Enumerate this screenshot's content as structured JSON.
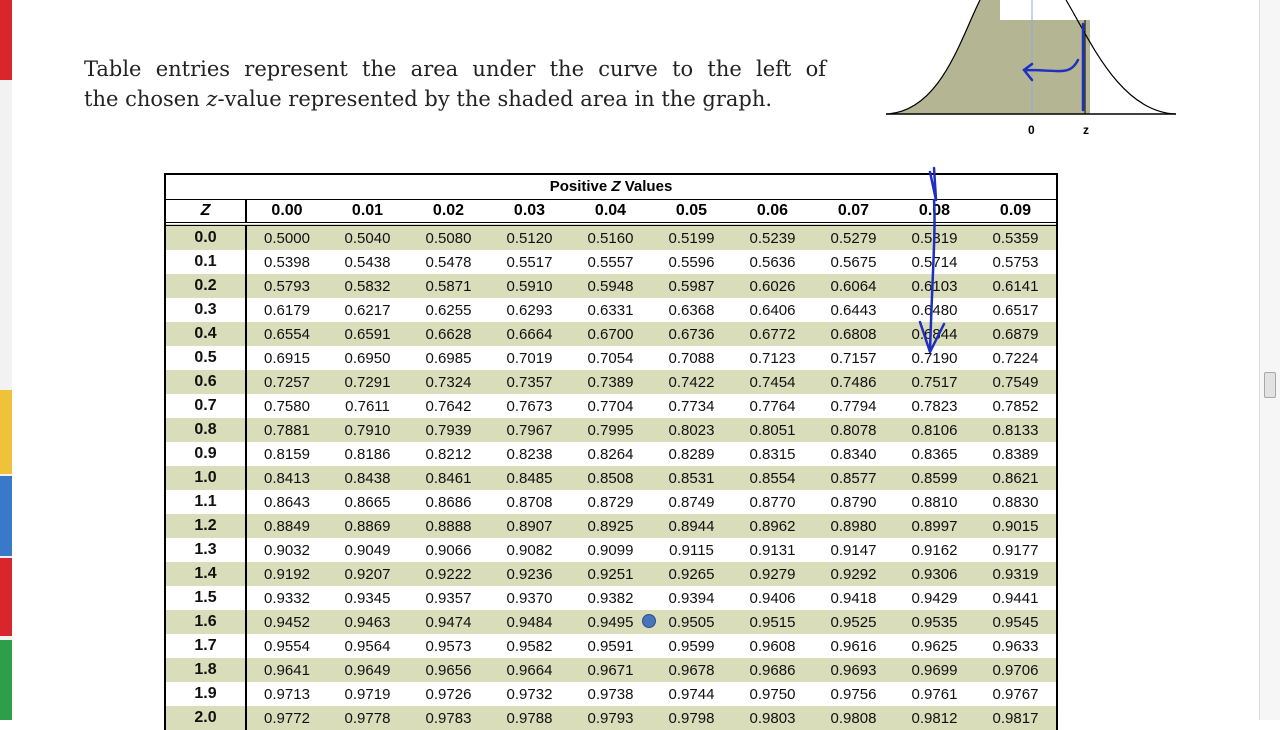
{
  "caption": {
    "line1": "Table entries represent the area under the curve to the left of",
    "line2_pre": "the chosen ",
    "line2_var": "z",
    "line2_post": "-value represented by the shaded area in the graph."
  },
  "graph": {
    "label_zero": "0",
    "label_z": "z",
    "fill_color": "#b4b693"
  },
  "table": {
    "title_pre": "Positive ",
    "title_var": "Z",
    "title_post": " Values",
    "corner_header": "Z",
    "columns": [
      "0.00",
      "0.01",
      "0.02",
      "0.03",
      "0.04",
      "0.05",
      "0.06",
      "0.07",
      "0.08",
      "0.09"
    ],
    "row_shade_color": "#d9ddb9",
    "rows": [
      {
        "z": "0.0",
        "v": [
          "0.5000",
          "0.5040",
          "0.5080",
          "0.5120",
          "0.5160",
          "0.5199",
          "0.5239",
          "0.5279",
          "0.5319",
          "0.5359"
        ]
      },
      {
        "z": "0.1",
        "v": [
          "0.5398",
          "0.5438",
          "0.5478",
          "0.5517",
          "0.5557",
          "0.5596",
          "0.5636",
          "0.5675",
          "0.5714",
          "0.5753"
        ]
      },
      {
        "z": "0.2",
        "v": [
          "0.5793",
          "0.5832",
          "0.5871",
          "0.5910",
          "0.5948",
          "0.5987",
          "0.6026",
          "0.6064",
          "0.6103",
          "0.6141"
        ]
      },
      {
        "z": "0.3",
        "v": [
          "0.6179",
          "0.6217",
          "0.6255",
          "0.6293",
          "0.6331",
          "0.6368",
          "0.6406",
          "0.6443",
          "0.6480",
          "0.6517"
        ]
      },
      {
        "z": "0.4",
        "v": [
          "0.6554",
          "0.6591",
          "0.6628",
          "0.6664",
          "0.6700",
          "0.6736",
          "0.6772",
          "0.6808",
          "0.6844",
          "0.6879"
        ]
      },
      {
        "z": "0.5",
        "v": [
          "0.6915",
          "0.6950",
          "0.6985",
          "0.7019",
          "0.7054",
          "0.7088",
          "0.7123",
          "0.7157",
          "0.7190",
          "0.7224"
        ]
      },
      {
        "z": "0.6",
        "v": [
          "0.7257",
          "0.7291",
          "0.7324",
          "0.7357",
          "0.7389",
          "0.7422",
          "0.7454",
          "0.7486",
          "0.7517",
          "0.7549"
        ]
      },
      {
        "z": "0.7",
        "v": [
          "0.7580",
          "0.7611",
          "0.7642",
          "0.7673",
          "0.7704",
          "0.7734",
          "0.7764",
          "0.7794",
          "0.7823",
          "0.7852"
        ]
      },
      {
        "z": "0.8",
        "v": [
          "0.7881",
          "0.7910",
          "0.7939",
          "0.7967",
          "0.7995",
          "0.8023",
          "0.8051",
          "0.8078",
          "0.8106",
          "0.8133"
        ]
      },
      {
        "z": "0.9",
        "v": [
          "0.8159",
          "0.8186",
          "0.8212",
          "0.8238",
          "0.8264",
          "0.8289",
          "0.8315",
          "0.8340",
          "0.8365",
          "0.8389"
        ]
      },
      {
        "z": "1.0",
        "v": [
          "0.8413",
          "0.8438",
          "0.8461",
          "0.8485",
          "0.8508",
          "0.8531",
          "0.8554",
          "0.8577",
          "0.8599",
          "0.8621"
        ]
      },
      {
        "z": "1.1",
        "v": [
          "0.8643",
          "0.8665",
          "0.8686",
          "0.8708",
          "0.8729",
          "0.8749",
          "0.8770",
          "0.8790",
          "0.8810",
          "0.8830"
        ]
      },
      {
        "z": "1.2",
        "v": [
          "0.8849",
          "0.8869",
          "0.8888",
          "0.8907",
          "0.8925",
          "0.8944",
          "0.8962",
          "0.8980",
          "0.8997",
          "0.9015"
        ]
      },
      {
        "z": "1.3",
        "v": [
          "0.9032",
          "0.9049",
          "0.9066",
          "0.9082",
          "0.9099",
          "0.9115",
          "0.9131",
          "0.9147",
          "0.9162",
          "0.9177"
        ]
      },
      {
        "z": "1.4",
        "v": [
          "0.9192",
          "0.9207",
          "0.9222",
          "0.9236",
          "0.9251",
          "0.9265",
          "0.9279",
          "0.9292",
          "0.9306",
          "0.9319"
        ]
      },
      {
        "z": "1.5",
        "v": [
          "0.9332",
          "0.9345",
          "0.9357",
          "0.9370",
          "0.9382",
          "0.9394",
          "0.9406",
          "0.9418",
          "0.9429",
          "0.9441"
        ]
      },
      {
        "z": "1.6",
        "v": [
          "0.9452",
          "0.9463",
          "0.9474",
          "0.9484",
          "0.9495",
          "0.9505",
          "0.9515",
          "0.9525",
          "0.9535",
          "0.9545"
        ]
      },
      {
        "z": "1.7",
        "v": [
          "0.9554",
          "0.9564",
          "0.9573",
          "0.9582",
          "0.9591",
          "0.9599",
          "0.9608",
          "0.9616",
          "0.9625",
          "0.9633"
        ]
      },
      {
        "z": "1.8",
        "v": [
          "0.9641",
          "0.9649",
          "0.9656",
          "0.9664",
          "0.9671",
          "0.9678",
          "0.9686",
          "0.9693",
          "0.9699",
          "0.9706"
        ]
      },
      {
        "z": "1.9",
        "v": [
          "0.9713",
          "0.9719",
          "0.9726",
          "0.9732",
          "0.9738",
          "0.9744",
          "0.9750",
          "0.9756",
          "0.9761",
          "0.9767"
        ]
      },
      {
        "z": "2.0",
        "v": [
          "0.9772",
          "0.9778",
          "0.9783",
          "0.9788",
          "0.9793",
          "0.9798",
          "0.9803",
          "0.9808",
          "0.9812",
          "0.9817"
        ]
      }
    ]
  },
  "annotation": {
    "pen_color": "#1f2fbf",
    "cursor_color": "#4a74b8"
  },
  "left_toolbar": {
    "colors": [
      "#d9262c",
      "#f0c23a",
      "#3a78c8",
      "#d9262c",
      "#2e9e4a"
    ]
  }
}
